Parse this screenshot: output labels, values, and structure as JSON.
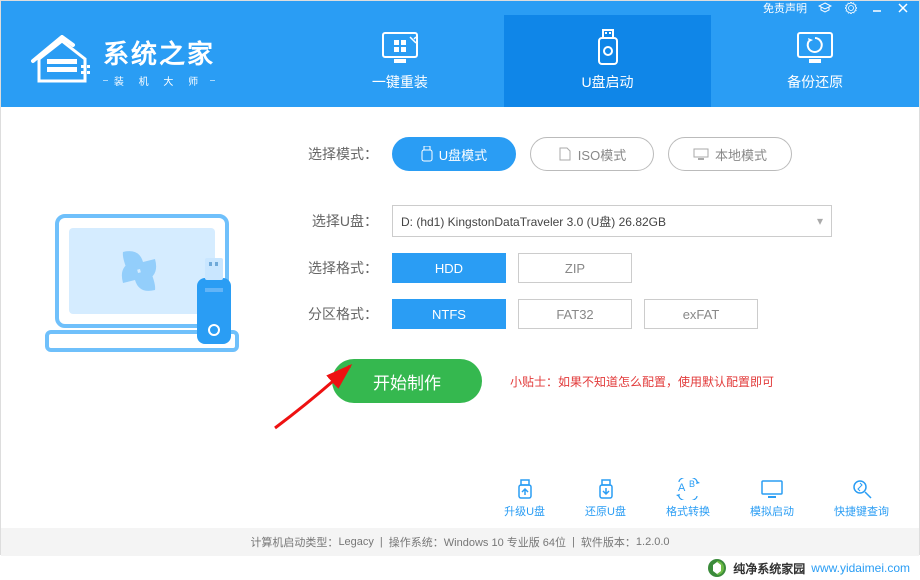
{
  "titlebar": {
    "disclaimer": "免责声明"
  },
  "logo": {
    "title": "系统之家",
    "subtitle": "装 机 大 师"
  },
  "tabs": {
    "reinstall": "一键重装",
    "usbboot": "U盘启动",
    "backup": "备份还原"
  },
  "mode_row": {
    "label": "选择模式：",
    "usb": "U盘模式",
    "iso": "ISO模式",
    "local": "本地模式"
  },
  "usb_row": {
    "label": "选择U盘：",
    "value": "D: (hd1) KingstonDataTraveler 3.0 (U盘) 26.82GB"
  },
  "format_row": {
    "label": "选择格式：",
    "hdd": "HDD",
    "zip": "ZIP"
  },
  "fs_row": {
    "label": "分区格式：",
    "ntfs": "NTFS",
    "fat32": "FAT32",
    "exfat": "exFAT"
  },
  "start": {
    "button": "开始制作"
  },
  "tip": {
    "prefix": "小贴士：",
    "text": "如果不知道怎么配置，使用默认配置即可"
  },
  "tools": {
    "upgrade": "升级U盘",
    "restore": "还原U盘",
    "convert": "格式转换",
    "emulate": "模拟启动",
    "hotkey": "快捷键查询"
  },
  "status": {
    "boot_label": "计算机启动类型：",
    "boot_value": "Legacy",
    "os_label": "操作系统：",
    "os_value": "Windows 10 专业版 64位",
    "ver_label": "软件版本：",
    "ver_value": "1.2.0.0"
  },
  "footer": {
    "brand": "纯净系统家园",
    "url": "www.yidaimei.com"
  }
}
